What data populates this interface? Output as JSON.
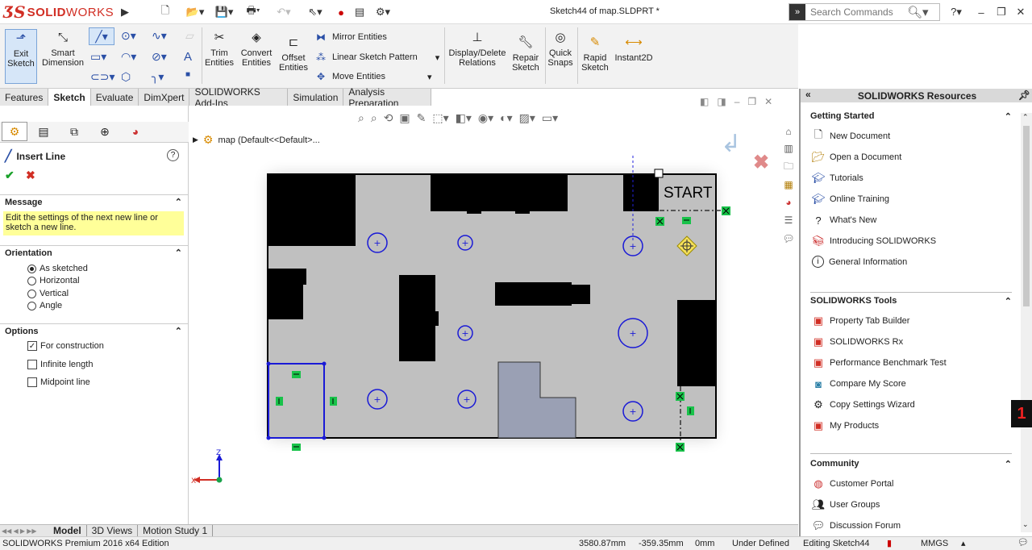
{
  "app": {
    "brand_ds": "ƷS",
    "brand_solid": "SOLID",
    "brand_works": "WORKS",
    "doc_title": "Sketch44 of map.SLDPRT *"
  },
  "search": {
    "placeholder": "Search Commands"
  },
  "ribbon": {
    "exit_sketch": "Exit Sketch",
    "smart_dimension": "Smart Dimension",
    "trim_entities": "Trim Entities",
    "convert_entities": "Convert Entities",
    "offset_entities": "Offset Entities",
    "mirror_entities": "Mirror Entities",
    "linear_sketch_pattern": "Linear Sketch Pattern",
    "move_entities": "Move Entities",
    "display_delete_relations": "Display/Delete Relations",
    "repair_sketch": "Repair Sketch",
    "quick_snaps": "Quick Snaps",
    "rapid_sketch": "Rapid Sketch",
    "instant2d": "Instant2D"
  },
  "tabs": [
    "Features",
    "Sketch",
    "Evaluate",
    "DimXpert",
    "SOLIDWORKS Add-Ins",
    "Simulation",
    "Analysis Preparation"
  ],
  "panel": {
    "title": "Insert Line",
    "message_header": "Message",
    "message_text": "Edit the settings of the next new line or sketch a new line.",
    "orientation_header": "Orientation",
    "orientation_options": [
      "As sketched",
      "Horizontal",
      "Vertical",
      "Angle"
    ],
    "options_header": "Options",
    "option_construction": "For construction",
    "option_infinite": "Infinite length",
    "option_midpoint": "Midpoint line"
  },
  "viewport": {
    "tree_label": "map  (Default<<Default>...",
    "start_label": "START",
    "axis_z": "Z",
    "axis_x": "X"
  },
  "resources": {
    "header": "SOLIDWORKS Resources",
    "getting_started": "Getting Started",
    "gs_items": [
      "New Document",
      "Open a Document",
      "Tutorials",
      "Online Training",
      "What's New",
      "Introducing SOLIDWORKS",
      "General Information"
    ],
    "tools": "SOLIDWORKS Tools",
    "tool_items": [
      "Property Tab Builder",
      "SOLIDWORKS Rx",
      "Performance Benchmark Test",
      "Compare My Score",
      "Copy Settings Wizard",
      "My Products"
    ],
    "community": "Community",
    "community_items": [
      "Customer Portal",
      "User Groups",
      "Discussion Forum"
    ]
  },
  "bottom_tabs": [
    "Model",
    "3D Views",
    "Motion Study 1"
  ],
  "status": {
    "edition": "SOLIDWORKS Premium 2016 x64 Edition",
    "x": "3580.87mm",
    "y": "-359.35mm",
    "z": "0mm",
    "state": "Under Defined",
    "editing": "Editing Sketch44",
    "units": "MMGS"
  },
  "colors": {
    "accent_red": "#d12e24",
    "sketch_blue": "#1a1ad6",
    "relation_green": "#19c24a",
    "message_yellow": "#ffff99"
  }
}
